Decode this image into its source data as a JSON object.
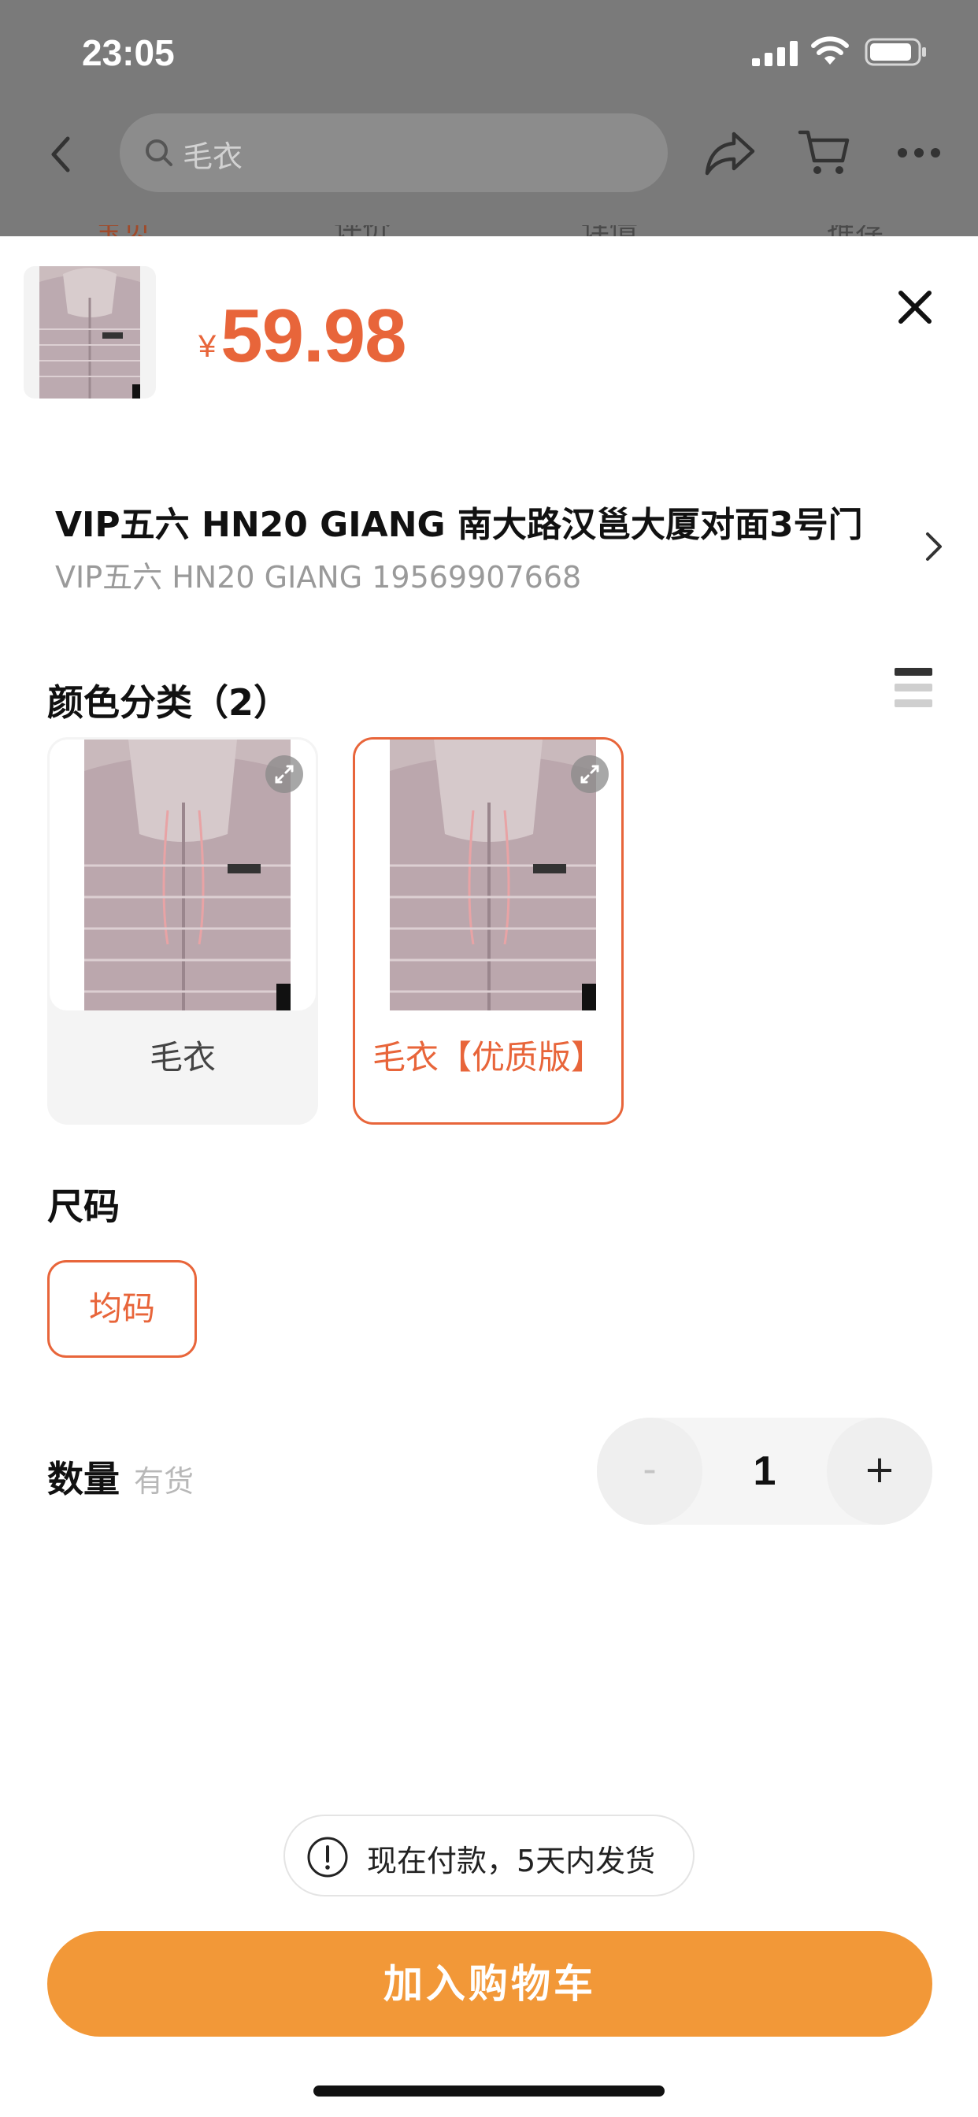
{
  "status_bar": {
    "time": "23:05"
  },
  "header": {
    "search_placeholder": "毛衣"
  },
  "background_tabs": [
    "宝贝",
    "评价",
    "详情",
    "推荐"
  ],
  "sheet": {
    "price_symbol": "¥",
    "price": "59.98",
    "address": {
      "title": "VIP五六 HN20 GIANG   南大路汉邕大厦对面3号门",
      "subtitle": "VIP五六  HN20 GIANG 19569907668"
    },
    "color_section": {
      "title": "颜色分类（2）",
      "options": [
        {
          "label": "毛衣",
          "selected": false
        },
        {
          "label": "毛衣【优质版】",
          "selected": true
        }
      ]
    },
    "size_section": {
      "title": "尺码",
      "options": [
        {
          "label": "均码",
          "selected": true
        }
      ]
    },
    "quantity": {
      "label": "数量",
      "stock": "有货",
      "minus": "-",
      "value": "1",
      "plus": "+"
    },
    "shipping_note": "现在付款，5天内发货",
    "add_to_cart": "加入购物车"
  },
  "colors": {
    "accent": "#e8653a",
    "button": "#f29838"
  }
}
